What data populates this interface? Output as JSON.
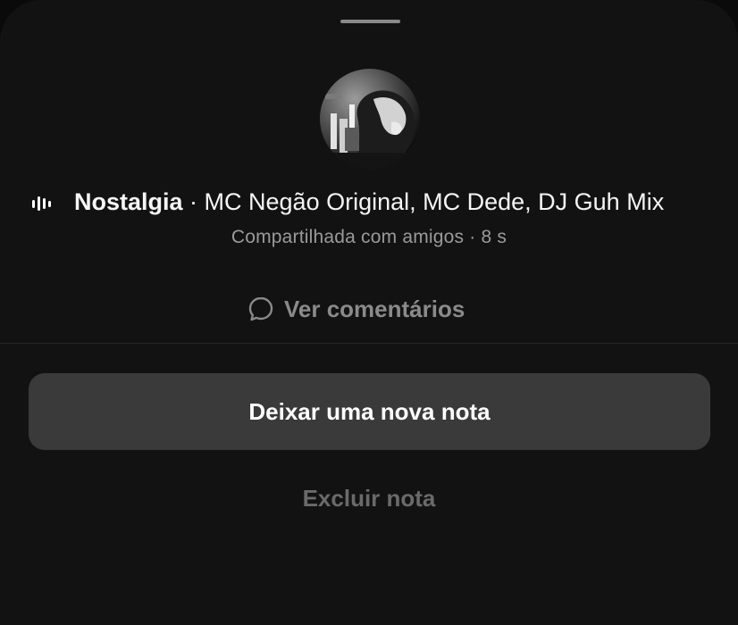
{
  "sheet": {
    "song": {
      "title": "Nostalgia",
      "separator": " · ",
      "artists": "MC Negão Original, MC Dede, DJ Guh Mix"
    },
    "shared_info": "Compartilhada com amigos · 8 s",
    "comments_label": "Ver comentários",
    "primary_action": "Deixar uma nova nota",
    "secondary_action": "Excluir nota"
  },
  "icons": {
    "audio": "audio-bars-icon",
    "comments": "comment-bubble-icon"
  },
  "colors": {
    "background": "#121212",
    "primary_button": "#3a3a3a",
    "text": "#f5f5f5",
    "muted_text": "#9a9a9a",
    "disabled_text": "#6a6a6a"
  }
}
